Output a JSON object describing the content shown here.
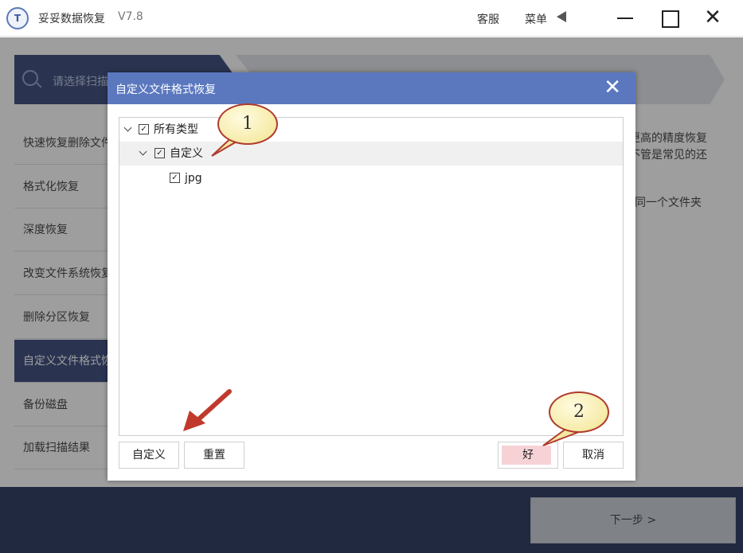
{
  "app": {
    "logo_text": "T",
    "title": "妥妥数据恢复",
    "version": "V7.8",
    "service_label": "客服",
    "menu_label": "菜单"
  },
  "search": {
    "placeholder_text": "请选择扫描"
  },
  "sidebar": {
    "items": [
      {
        "label": "快速恢复删除文件"
      },
      {
        "label": "格式化恢复"
      },
      {
        "label": "深度恢复"
      },
      {
        "label": "改变文件系统恢复"
      },
      {
        "label": "删除分区恢复"
      },
      {
        "label": "自定义文件格式恢复"
      },
      {
        "label": "备份磁盘"
      },
      {
        "label": "加载扫描结果"
      }
    ]
  },
  "description": {
    "line1": "更高的精度恢复",
    "line2": "不管是常见的还",
    "line3": "同一个文件夹"
  },
  "footer": {
    "next_label": "下一步 >"
  },
  "dialog": {
    "title": "自定义文件格式恢复",
    "tree": [
      {
        "label": "所有类型",
        "checked": true
      },
      {
        "label": "自定义",
        "checked": true
      },
      {
        "label": "jpg",
        "checked": true
      }
    ],
    "check_mark": "✓",
    "buttons": {
      "custom": "自定义",
      "reset": "重置",
      "ok": "好",
      "cancel": "取消"
    }
  },
  "callouts": {
    "one": "1",
    "two": "2"
  },
  "colors": {
    "header_blue": "#5b78bf",
    "nav_dark": "#2c3e73",
    "footer_dark": "#1b2a55",
    "callout_border": "#b03a2e",
    "arrow_red": "#c0392b"
  },
  "icons": {
    "close": "close-icon",
    "minimize": "minimize-icon",
    "maximize": "maximize-icon",
    "search": "search-icon",
    "menu_arrow": "triangle-left-icon"
  }
}
